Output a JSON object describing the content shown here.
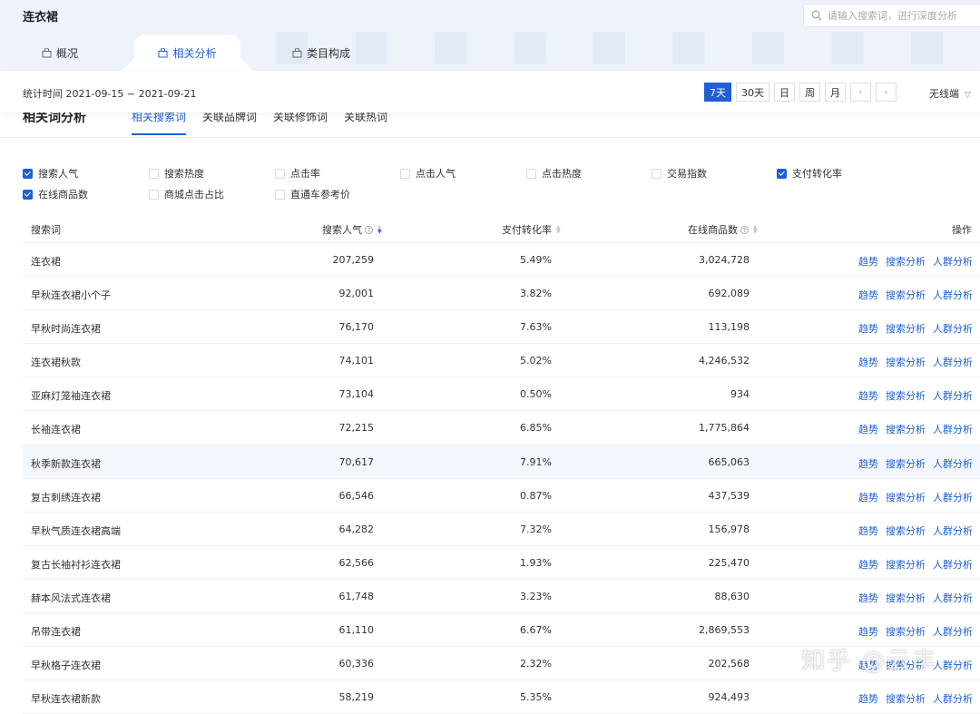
{
  "header": {
    "title": "连衣裙",
    "search_placeholder": "请输入搜索词，进行深度分析",
    "tabs": [
      {
        "label": "概况",
        "active": false
      },
      {
        "label": "相关分析",
        "active": true
      },
      {
        "label": "类目构成",
        "active": false
      }
    ]
  },
  "datebar": {
    "stat_time": "统计时间 2021-09-15 ~ 2021-09-21",
    "periods": [
      {
        "label": "7天",
        "active": true
      },
      {
        "label": "30天",
        "active": false
      },
      {
        "label": "日",
        "active": false
      },
      {
        "label": "周",
        "active": false
      },
      {
        "label": "月",
        "active": false
      }
    ],
    "prev": "‹",
    "next": "›",
    "device": "无线端"
  },
  "section": {
    "title": "相关词分析",
    "subtabs": [
      {
        "label": "相关搜索词",
        "active": true
      },
      {
        "label": "关联品牌词",
        "active": false
      },
      {
        "label": "关联修饰词",
        "active": false
      },
      {
        "label": "关联热词",
        "active": false
      }
    ]
  },
  "metrics": [
    {
      "label": "搜索人气",
      "checked": true
    },
    {
      "label": "搜索热度",
      "checked": false
    },
    {
      "label": "点击率",
      "checked": false
    },
    {
      "label": "点击人气",
      "checked": false
    },
    {
      "label": "点击热度",
      "checked": false
    },
    {
      "label": "交易指数",
      "checked": false
    },
    {
      "label": "支付转化率",
      "checked": true
    },
    {
      "label": "在线商品数",
      "checked": true
    },
    {
      "label": "商城点击占比",
      "checked": false
    },
    {
      "label": "直通车参考价",
      "checked": false
    }
  ],
  "table": {
    "columns": {
      "keyword": "搜索词",
      "popularity": "搜索人气",
      "conversion": "支付转化率",
      "products": "在线商品数",
      "actions": "操作"
    },
    "actions": [
      "趋势",
      "搜索分析",
      "人群分析"
    ],
    "rows": [
      {
        "keyword": "连衣裙",
        "popularity": "207,259",
        "conversion": "5.49%",
        "products": "3,024,728"
      },
      {
        "keyword": "早秋连衣裙小个子",
        "popularity": "92,001",
        "conversion": "3.82%",
        "products": "692,089"
      },
      {
        "keyword": "早秋时尚连衣裙",
        "popularity": "76,170",
        "conversion": "7.63%",
        "products": "113,198"
      },
      {
        "keyword": "连衣裙秋款",
        "popularity": "74,101",
        "conversion": "5.02%",
        "products": "4,246,532"
      },
      {
        "keyword": "亚麻灯笼袖连衣裙",
        "popularity": "73,104",
        "conversion": "0.50%",
        "products": "934"
      },
      {
        "keyword": "长袖连衣裙",
        "popularity": "72,215",
        "conversion": "6.85%",
        "products": "1,775,864"
      },
      {
        "keyword": "秋季新款连衣裙",
        "popularity": "70,617",
        "conversion": "7.91%",
        "products": "665,063",
        "highlight": true
      },
      {
        "keyword": "复古刺绣连衣裙",
        "popularity": "66,546",
        "conversion": "0.87%",
        "products": "437,539"
      },
      {
        "keyword": "早秋气质连衣裙高端",
        "popularity": "64,282",
        "conversion": "7.32%",
        "products": "156,978"
      },
      {
        "keyword": "复古长袖衬衫连衣裙",
        "popularity": "62,566",
        "conversion": "1.93%",
        "products": "225,470"
      },
      {
        "keyword": "赫本风法式连衣裙",
        "popularity": "61,748",
        "conversion": "3.23%",
        "products": "88,630"
      },
      {
        "keyword": "吊带连衣裙",
        "popularity": "61,110",
        "conversion": "6.67%",
        "products": "2,869,553"
      },
      {
        "keyword": "早秋格子连衣裙",
        "popularity": "60,336",
        "conversion": "2.32%",
        "products": "202,568"
      },
      {
        "keyword": "早秋连衣裙新款",
        "popularity": "58,219",
        "conversion": "5.35%",
        "products": "924,493"
      }
    ]
  },
  "watermark": "知乎 @云丰",
  "colors": {
    "accent": "#1e5fd8"
  }
}
